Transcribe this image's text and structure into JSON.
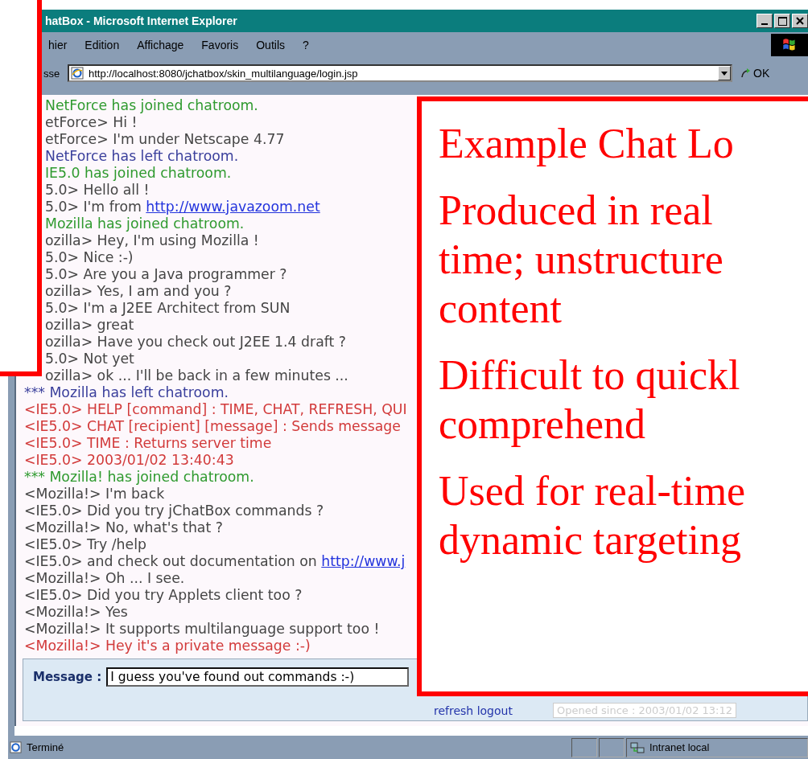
{
  "window": {
    "title": "hatBox - Microsoft Internet Explorer"
  },
  "menu": [
    "hier",
    "Edition",
    "Affichage",
    "Favoris",
    "Outils",
    "?"
  ],
  "address_bar": {
    "label": "sse",
    "value": "http://localhost:8080/jchatbox/skin_multilanguage/login.jsp",
    "go": "OK"
  },
  "chat": [
    {
      "kind": "join",
      "text": "NetForce has joined chatroom."
    },
    {
      "kind": "msg",
      "text": "etForce> Hi !"
    },
    {
      "kind": "msg",
      "text": "etForce> I'm under Netscape 4.77"
    },
    {
      "kind": "leave",
      "text": "NetForce has left chatroom."
    },
    {
      "kind": "join",
      "text": "IE5.0 has joined chatroom."
    },
    {
      "kind": "msg",
      "text": "5.0> Hello all !"
    },
    {
      "kind": "msg",
      "text": "5.0> I'm from ",
      "link": "http://www.javazoom.net"
    },
    {
      "kind": "join",
      "text": "Mozilla has joined chatroom."
    },
    {
      "kind": "msg",
      "text": "ozilla> Hey, I'm using Mozilla !"
    },
    {
      "kind": "msg",
      "text": "5.0> Nice :-)"
    },
    {
      "kind": "msg",
      "text": "5.0> Are you a Java programmer ?"
    },
    {
      "kind": "msg",
      "text": "ozilla> Yes, I am and you ?"
    },
    {
      "kind": "msg",
      "text": "5.0> I'm a J2EE Architect from SUN"
    },
    {
      "kind": "msg",
      "text": "ozilla> great"
    },
    {
      "kind": "msg",
      "text": "ozilla> Have you check out J2EE 1.4 draft ?"
    },
    {
      "kind": "msg",
      "text": "5.0> Not yet"
    },
    {
      "kind": "msg",
      "text": "ozilla> ok ... I'll be back in a few minutes ..."
    },
    {
      "kind": "leave",
      "text": "*** Mozilla has left chatroom."
    },
    {
      "kind": "private",
      "text": "<IE5.0> HELP [command] : TIME, CHAT, REFRESH, QUI"
    },
    {
      "kind": "private",
      "text": "<IE5.0> CHAT [recipient] [message] : Sends message"
    },
    {
      "kind": "private",
      "text": "<IE5.0> TIME : Returns server time"
    },
    {
      "kind": "private",
      "text": "<IE5.0> 2003/01/02 13:40:43"
    },
    {
      "kind": "join",
      "text": "*** Mozilla! has joined chatroom."
    },
    {
      "kind": "msg",
      "text": "<Mozilla!> I'm back"
    },
    {
      "kind": "msg",
      "text": "<IE5.0> Did you try jChatBox commands ?"
    },
    {
      "kind": "msg",
      "text": "<Mozilla!> No, what's that ?"
    },
    {
      "kind": "msg",
      "text": "<IE5.0> Try /help"
    },
    {
      "kind": "msg",
      "text": "<IE5.0> and check out documentation on ",
      "link": "http://www.j"
    },
    {
      "kind": "msg",
      "text": "<Mozilla!> Oh ... I see."
    },
    {
      "kind": "msg",
      "text": "<IE5.0> Did you try Applets client too ?"
    },
    {
      "kind": "msg",
      "text": "<Mozilla!> Yes"
    },
    {
      "kind": "msg",
      "text": "<Mozilla!> It supports multilanguage support too !"
    },
    {
      "kind": "private",
      "text": "<Mozilla!> Hey it's a private message :-)"
    }
  ],
  "message_form": {
    "label": "Message :",
    "value": "I guess you've found out commands :-)",
    "links": "refresh logout",
    "opened": "Opened since : 2003/01/02 13:12"
  },
  "status_bar": {
    "status": "Terminé",
    "zone": "Intranet local"
  },
  "slide_callout": [
    "Example Chat Lo",
    "Produced in real",
    "time; unstructure",
    "content",
    "Difficult to quickl",
    "comprehend",
    "Used for real-time",
    "dynamic targeting"
  ]
}
